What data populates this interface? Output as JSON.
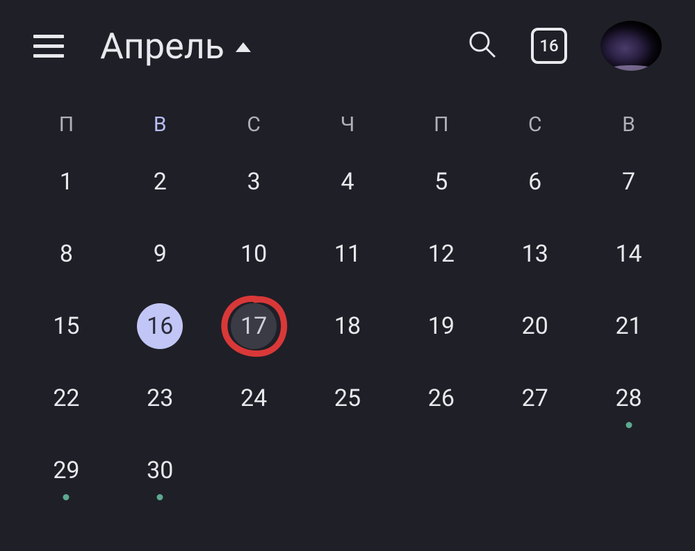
{
  "header": {
    "month_label": "Апрель",
    "today_number": "16"
  },
  "weekdays": [
    "П",
    "В",
    "С",
    "Ч",
    "П",
    "С",
    "В"
  ],
  "highlighted_weekday_index": 1,
  "today_index": 15,
  "selected_index": 16,
  "circled_index": 16,
  "days": [
    {
      "n": "1"
    },
    {
      "n": "2"
    },
    {
      "n": "3"
    },
    {
      "n": "4"
    },
    {
      "n": "5"
    },
    {
      "n": "6"
    },
    {
      "n": "7"
    },
    {
      "n": "8"
    },
    {
      "n": "9"
    },
    {
      "n": "10"
    },
    {
      "n": "11"
    },
    {
      "n": "12"
    },
    {
      "n": "13"
    },
    {
      "n": "14"
    },
    {
      "n": "15"
    },
    {
      "n": "16"
    },
    {
      "n": "17"
    },
    {
      "n": "18"
    },
    {
      "n": "19"
    },
    {
      "n": "20"
    },
    {
      "n": "21"
    },
    {
      "n": "22"
    },
    {
      "n": "23"
    },
    {
      "n": "24"
    },
    {
      "n": "25"
    },
    {
      "n": "26"
    },
    {
      "n": "27"
    },
    {
      "n": "28",
      "event": true
    },
    {
      "n": "29",
      "event": true
    },
    {
      "n": "30",
      "event": true
    }
  ]
}
